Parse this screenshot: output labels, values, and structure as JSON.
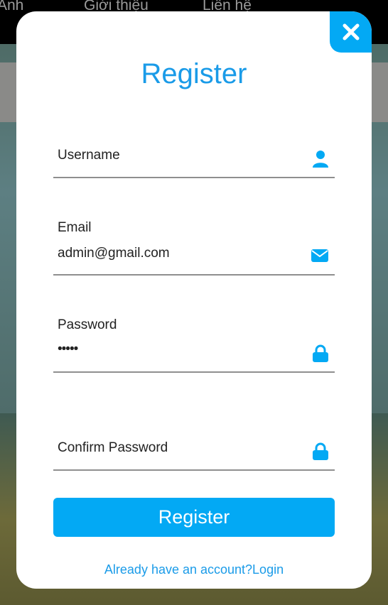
{
  "background": {
    "nav_items": [
      "Ảnh",
      "Giới thiệu",
      "Liên hệ"
    ]
  },
  "modal": {
    "title": "Register",
    "close_icon": "close-icon",
    "fields": {
      "username": {
        "label": "Username",
        "value": "",
        "icon": "user-icon"
      },
      "email": {
        "label": "Email",
        "value": "admin@gmail.com",
        "icon": "envelope-icon"
      },
      "password": {
        "label": "Password",
        "value": "•••••",
        "icon": "lock-icon"
      },
      "confirm_password": {
        "label": "Confirm Password",
        "value": "",
        "icon": "lock-icon"
      }
    },
    "submit_label": "Register",
    "login_link": "Already have an account?Login",
    "accent_color": "#03a9f4"
  }
}
